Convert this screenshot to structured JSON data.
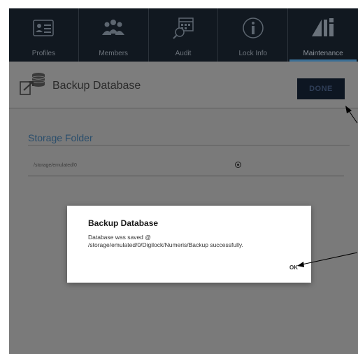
{
  "nav": {
    "tabs": [
      {
        "label": "Profiles",
        "icon": "profile-card-icon"
      },
      {
        "label": "Members",
        "icon": "members-icon"
      },
      {
        "label": "Audit",
        "icon": "audit-icon"
      },
      {
        "label": "Lock Info",
        "icon": "lock-info-icon"
      },
      {
        "label": "Maintenance",
        "icon": "maintenance-icon"
      }
    ],
    "active_tab": "Maintenance"
  },
  "header": {
    "title": "Backup Database",
    "done_label": "DONE"
  },
  "storage": {
    "title": "Storage Folder",
    "path": "/storage/emulated/0"
  },
  "dialog": {
    "title": "Backup Database",
    "message_line1": "Database was saved @",
    "message_line2": "/storage/emulated/0/Digilock/Numeris/Backup successfully.",
    "ok_label": "OK"
  },
  "colors": {
    "nav_bg": "#111820",
    "accent": "#3b6f95",
    "overlay": "#7a7a7a",
    "done_bg": "#0d1622"
  }
}
